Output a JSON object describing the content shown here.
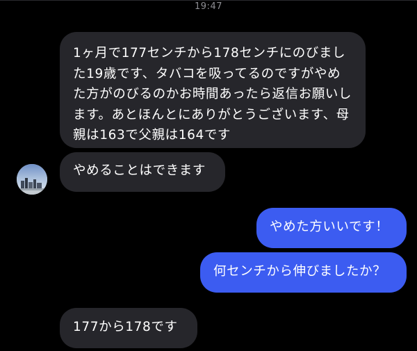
{
  "status": {
    "time": "19:47"
  },
  "messages": [
    {
      "sender": "them",
      "text": "1ヶ月で177センチから178センチにのびました19歳です、タバコを吸ってるのですがやめた方がのびるのかお時間あったら返信お願いします。あとほんとにありがとうございます、母親は163で父親は164です"
    },
    {
      "sender": "them",
      "text": "やめることはできます"
    },
    {
      "sender": "me",
      "text": "やめた方いいです！"
    },
    {
      "sender": "me",
      "text": "何センチから伸びましたか？"
    },
    {
      "sender": "them",
      "text": "177から178です"
    }
  ],
  "colors": {
    "background": "#000000",
    "incoming_bubble": "#26262b",
    "outgoing_bubble": "#3c5cf1",
    "timestamp_text": "#8e8e93"
  }
}
